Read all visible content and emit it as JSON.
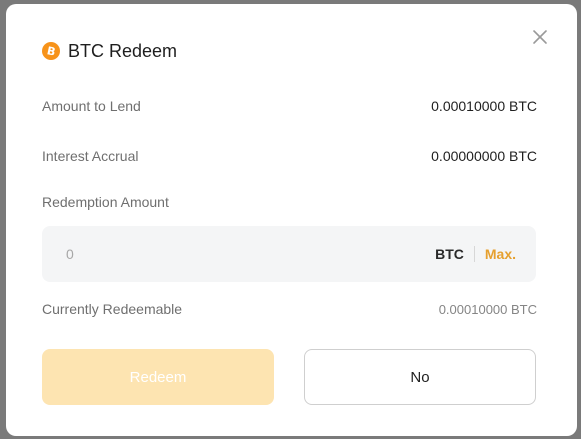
{
  "modal": {
    "title": "BTC Redeem",
    "coin_icon_glyph": "B",
    "coin_color": "#f7931a",
    "close_icon": "close-icon"
  },
  "details": {
    "amount_to_lend_label": "Amount to Lend",
    "amount_to_lend_value": "0.00010000 BTC",
    "interest_accrual_label": "Interest Accrual",
    "interest_accrual_value": "0.00000000 BTC"
  },
  "redemption": {
    "label": "Redemption Amount",
    "input_value": "",
    "placeholder": "0",
    "unit": "BTC",
    "max_label": "Max.",
    "accent_color": "#e6a02e"
  },
  "redeemable": {
    "label": "Currently Redeemable",
    "value": "0.00010000 BTC"
  },
  "buttons": {
    "redeem_label": "Redeem",
    "no_label": "No",
    "redeem_bg": "#fde4b1"
  }
}
